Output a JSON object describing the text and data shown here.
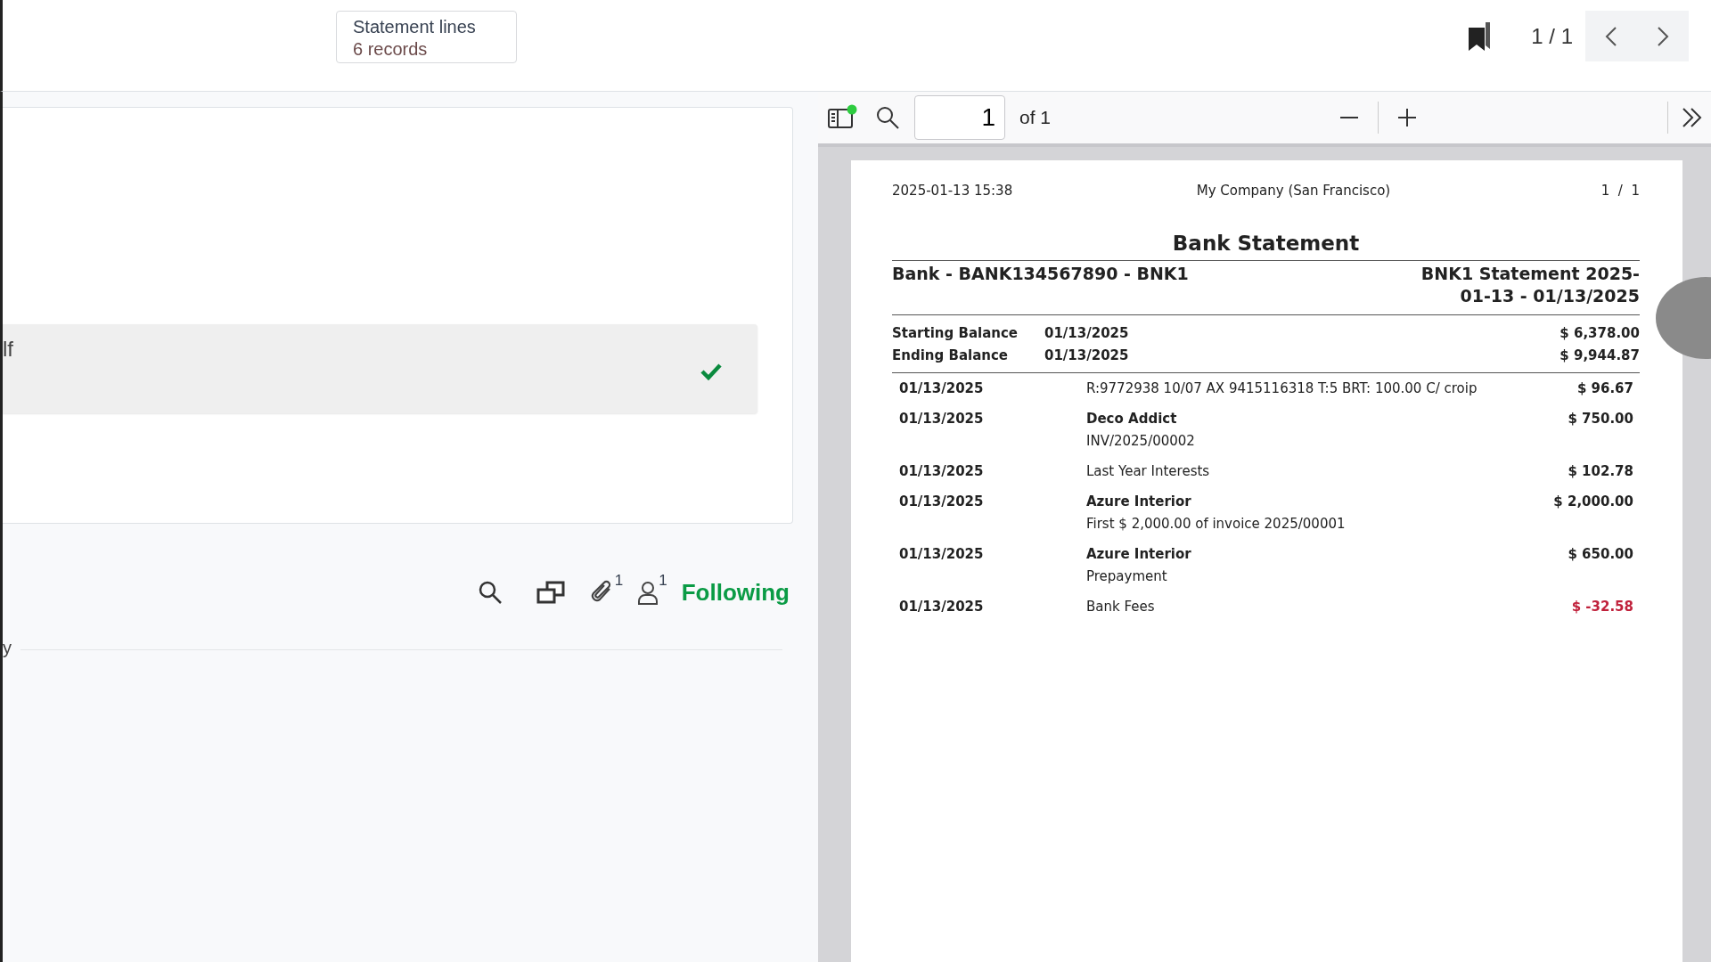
{
  "top_bar": {
    "smart_button": {
      "title": "Statement lines",
      "count": "6 records"
    },
    "pager": "1 / 1"
  },
  "form_card": {
    "row_text": "lf",
    "row_checked": true
  },
  "chatter": {
    "attachments_count": "1",
    "followers_count": "1",
    "follow_label": "Following",
    "following": true,
    "log_fragment": "y"
  },
  "pdf_viewer": {
    "page_input": "1",
    "page_total": "of 1",
    "document": {
      "header": {
        "printed_at": "2025-01-13 15:38",
        "company": "My Company (San Francisco)",
        "page": "1  /  1"
      },
      "title": "Bank Statement",
      "journal": "Bank - BANK134567890 - BNK1",
      "statement": "BNK1 Statement 2025-01-13 - 01/13/2025",
      "balances": [
        {
          "label": "Starting Balance",
          "date": "01/13/2025",
          "amount": "$ 6,378.00"
        },
        {
          "label": "Ending Balance",
          "date": "01/13/2025",
          "amount": "$ 9,944.87"
        }
      ],
      "lines": [
        {
          "date": "01/13/2025",
          "label": "R:9772938 10/07 AX 9415116318 T:5 BRT: 100.00 C/ croip",
          "amount": "$ 96.67",
          "negative": false
        },
        {
          "date": "01/13/2025",
          "partner": "Deco Addict",
          "label": "INV/2025/00002",
          "amount": "$ 750.00",
          "negative": false
        },
        {
          "date": "01/13/2025",
          "label": "Last Year Interests",
          "amount": "$ 102.78",
          "negative": false
        },
        {
          "date": "01/13/2025",
          "partner": "Azure Interior",
          "label": "First $ 2,000.00 of invoice 2025/00001",
          "amount": "$ 2,000.00",
          "negative": false
        },
        {
          "date": "01/13/2025",
          "partner": "Azure Interior",
          "label": "Prepayment",
          "amount": "$ 650.00",
          "negative": false
        },
        {
          "date": "01/13/2025",
          "label": "Bank Fees",
          "amount": "$ -32.58",
          "negative": true
        }
      ]
    }
  }
}
